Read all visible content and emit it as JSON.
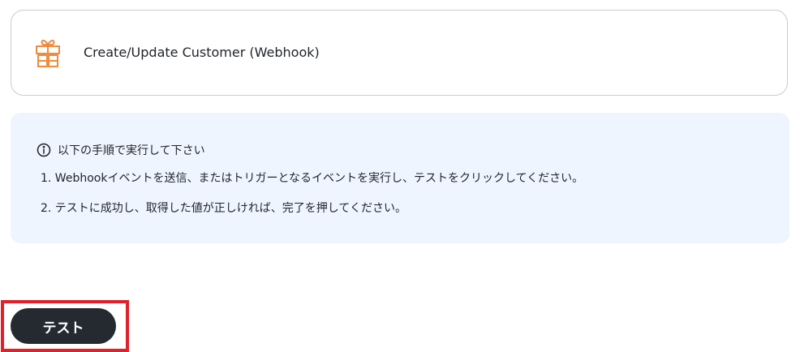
{
  "trigger": {
    "icon": "gift-box-icon",
    "icon_color": "#f08a3c",
    "label": "Create/Update Customer (Webhook)"
  },
  "instructions": {
    "icon": "info-circle-icon",
    "title": "以下の手順で実行して下さい",
    "background": "#eef5fe",
    "steps": [
      "1. Webhookイベントを送信、またはトリガーとなるイベントを実行し、テストをクリックしてください。",
      "2. テストに成功し、取得した値が正しければ、完了を押してください。"
    ]
  },
  "test_button": {
    "label": "テスト",
    "background": "#252a31",
    "highlight_color": "#e1202a"
  }
}
